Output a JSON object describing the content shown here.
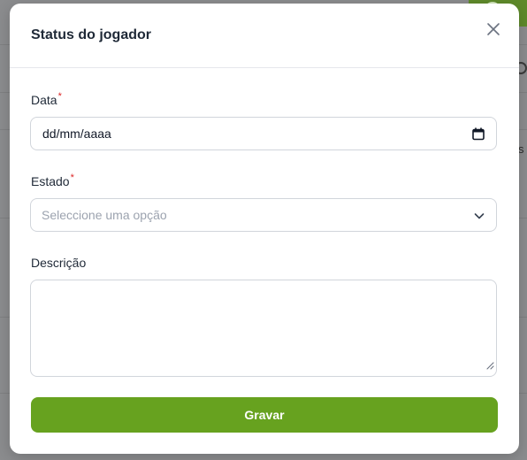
{
  "modal": {
    "title": "Status do jogador",
    "close_icon": "close-icon"
  },
  "form": {
    "date": {
      "label": "Data",
      "required_mark": "*",
      "value": "dd/mm/aaaa",
      "icon": "calendar-icon"
    },
    "state": {
      "label": "Estado",
      "required_mark": "*",
      "placeholder": "Seleccione uma opção",
      "icon": "chevron-down-icon"
    },
    "description": {
      "label": "Descrição",
      "value": ""
    },
    "submit_label": "Gravar"
  },
  "background": {
    "partial_text": "s"
  },
  "colors": {
    "accent": "#67a21f",
    "required": "#dc2626",
    "overlay": "#8b8c8e"
  }
}
